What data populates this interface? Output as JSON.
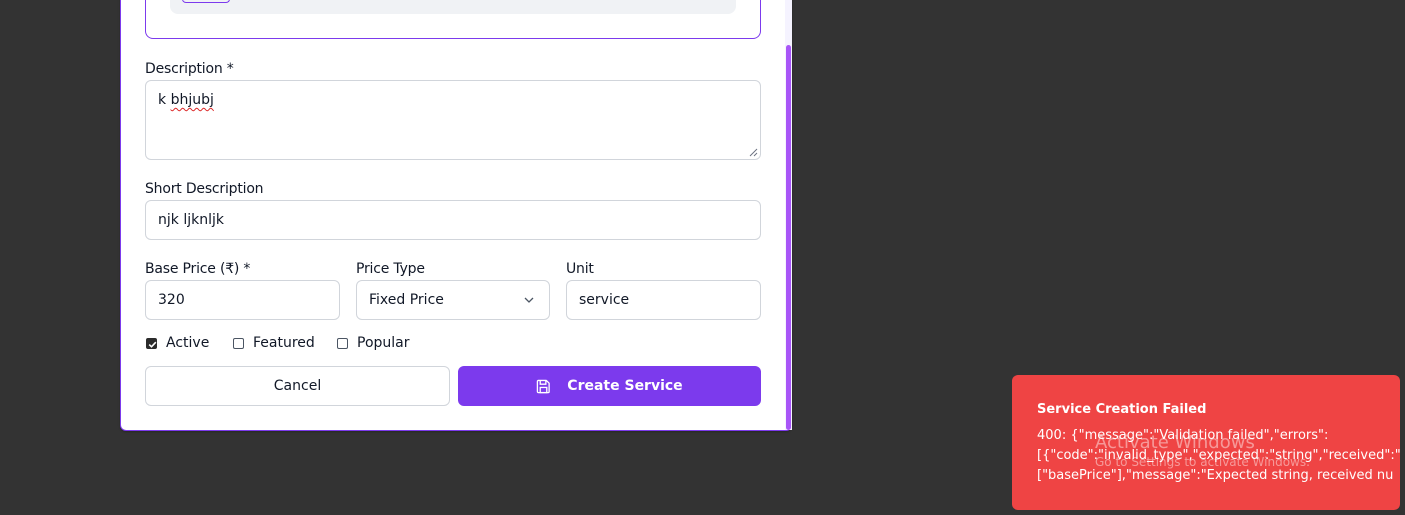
{
  "form": {
    "description": {
      "label": "Description *",
      "value_plain": "k ",
      "value_misspelled": "bhjubj"
    },
    "short_description": {
      "label": "Short Description",
      "value": "njk ljknljk"
    },
    "base_price": {
      "label": "Base Price (₹) *",
      "value": "320"
    },
    "price_type": {
      "label": "Price Type",
      "value": "Fixed Price"
    },
    "unit": {
      "label": "Unit",
      "value": "service"
    },
    "checkboxes": [
      {
        "label": "Active",
        "checked": true
      },
      {
        "label": "Featured",
        "checked": false
      },
      {
        "label": "Popular",
        "checked": false
      }
    ],
    "cancel_label": "Cancel",
    "create_label": "Create Service"
  },
  "toast": {
    "title": "Service Creation Failed",
    "message_lines": [
      "400: {\"message\":\"Validation failed\",\"errors\":",
      "[{\"code\":\"invalid_type\",\"expected\":\"string\",\"received\":\"",
      "[\"basePrice\"],\"message\":\"Expected string, received nu"
    ]
  },
  "watermark": {
    "title": "Activate Windows",
    "subtitle": "Go to Settings to activate Windows."
  },
  "colors": {
    "accent": "#7c3aed",
    "scrollbar": "#a855f7",
    "toast_bg": "#ef4444",
    "backdrop": "#333333"
  },
  "icons": {
    "save": "save-icon",
    "chevron": "chevron-down-icon",
    "check": "check-icon"
  }
}
